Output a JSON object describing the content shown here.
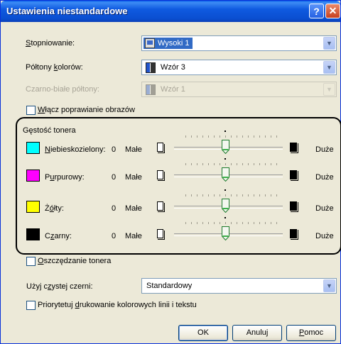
{
  "window": {
    "title": "Ustawienia niestandardowe",
    "help_glyph": "?",
    "close_glyph": "✕"
  },
  "halftone": {
    "label_pre": "S",
    "label_post": "topniowanie:",
    "value": "Wysoki 1"
  },
  "color_halftone": {
    "label_pre": "Półtony ",
    "label_u": "k",
    "label_post": "olorów:",
    "value": "Wzór 3"
  },
  "bw_halftone": {
    "label": "Czarno-białe półtony:",
    "value": "Wzór 1",
    "disabled": true
  },
  "image_refinement": {
    "label_u": "W",
    "label_post": "łącz poprawianie obrazów",
    "checked": false
  },
  "toner_density": {
    "title": "Gęstość tonera",
    "rows": [
      {
        "name_u": "N",
        "name_post": "iebieskozielony:",
        "value": "0",
        "low": "Małe",
        "high": "Duże",
        "color": "#00ffff"
      },
      {
        "name_pre": "P",
        "name_u": "u",
        "name_post": "rpurowy:",
        "value": "0",
        "low": "Małe",
        "high": "Duże",
        "color": "#ff00ff"
      },
      {
        "name_pre": "Ż",
        "name_u": "ó",
        "name_post": "łty:",
        "value": "0",
        "low": "Małe",
        "high": "Duże",
        "color": "#ffff00"
      },
      {
        "name_pre": "C",
        "name_u": "z",
        "name_post": "arny:",
        "value": "0",
        "low": "Małe",
        "high": "Duże",
        "color": "#000000"
      }
    ]
  },
  "toner_save": {
    "label_u": "O",
    "label_post": "szczędzanie tonera",
    "checked": false
  },
  "pure_black": {
    "label_pre": "Użyj c",
    "label_u": "z",
    "label_post": "ystej czerni:",
    "value": "Standardowy"
  },
  "prioritize": {
    "label_pre": "Priorytetuj ",
    "label_u": "d",
    "label_post": "rukowanie kolorowych linii i tekstu",
    "checked": false
  },
  "buttons": {
    "ok": "OK",
    "cancel": "Anuluj",
    "help_u": "P",
    "help_post": "omoc"
  }
}
